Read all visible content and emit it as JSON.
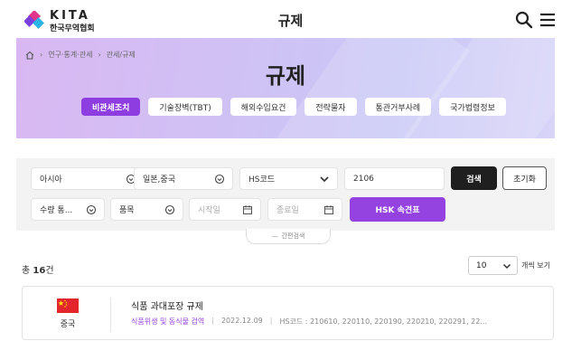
{
  "header": {
    "logo_main": "KITA",
    "logo_sub": "한국무역협회",
    "title": "규제"
  },
  "hero": {
    "breadcrumb": [
      "연구·통계·관세",
      "관세/규제"
    ],
    "title": "규제",
    "tabs": [
      {
        "label": "비관세조치",
        "active": true
      },
      {
        "label": "기술장벽(TBT)",
        "active": false
      },
      {
        "label": "해외수입요건",
        "active": false
      },
      {
        "label": "전략물자",
        "active": false
      },
      {
        "label": "통관거부사례",
        "active": false
      },
      {
        "label": "국가법령정보",
        "active": false
      }
    ]
  },
  "search": {
    "region": "아시아",
    "country": "일본,중국",
    "code_type": "HS코드",
    "code_value": "2106",
    "search_label": "검색",
    "reset_label": "초기화",
    "filter_type": "수량 통...",
    "item": "품목",
    "start_placeholder": "시작일",
    "end_placeholder": "종료일",
    "hsk_label": "HSK 속견표",
    "simple_search": "간편검색"
  },
  "results": {
    "total_prefix": "총",
    "total_count": "16",
    "total_suffix": "건",
    "per_page": "10",
    "per_page_label": "개씩 보기",
    "items": [
      {
        "country": "중국",
        "title": "식품 과대포장 규제",
        "category": "식품위생 및 동식물 검역",
        "date": "2022.12.09",
        "hs_codes": "HS코드 : 210610, 220110, 220190, 220210, 220291, 22..."
      }
    ]
  },
  "colors": {
    "accent": "#9442e0",
    "hero_bg": "#cfc2f5",
    "dark_button": "#1f1f1f",
    "flag_red": "#e3262b"
  }
}
